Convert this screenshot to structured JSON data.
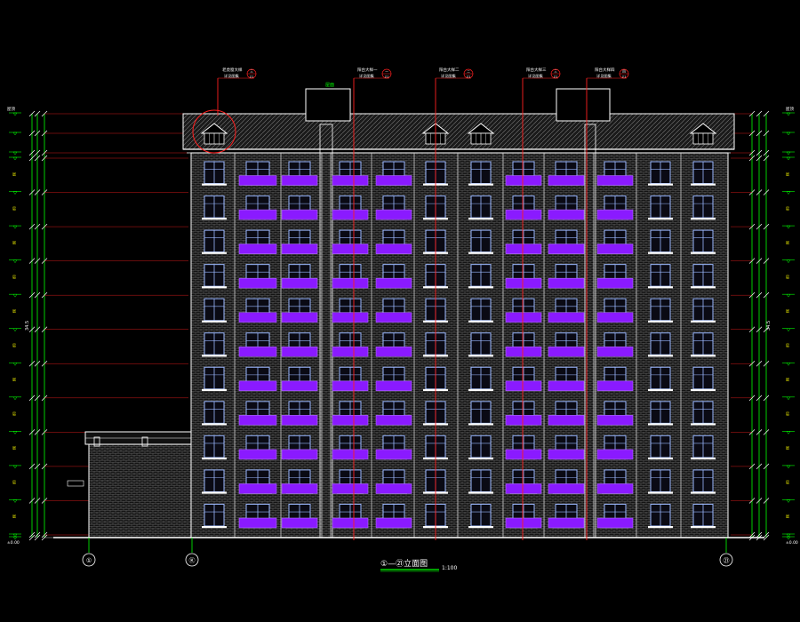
{
  "title": {
    "main": "①—㉑立面图",
    "scale": "1:100"
  },
  "grid_axes": {
    "left": "①",
    "middle": "Ⓚ",
    "right": "㉑"
  },
  "section_callouts": [
    {
      "text": "老虎窗大样",
      "sub": "详见图集",
      "ref": "三",
      "page": "21"
    },
    {
      "text": "阳台大样一",
      "sub": "详见图集",
      "ref": "一",
      "page": "21"
    },
    {
      "text": "阳台大样二",
      "sub": "详见图集",
      "ref": "二",
      "page": "21"
    },
    {
      "text": "阳台大样三",
      "sub": "详见图集",
      "ref": "三",
      "page": "21"
    },
    {
      "text": "阳台大样四",
      "sub": "详见图集",
      "ref": "四",
      "page": "21"
    }
  ],
  "roof_labels": {
    "stair_tower": "屋面",
    "roof_mark": "屋顶"
  },
  "level_labels": {
    "ground": "±0.00",
    "ground_right": "±0.00",
    "floor_tag": "层",
    "overall": "34.5",
    "left_top": "屋顶",
    "right_top": "屋顶"
  },
  "colors": {
    "background": "#000000",
    "structure": "#ffffff",
    "dimension": "#00ff00",
    "leader": "#ff2020",
    "window": "#9bb8ff",
    "balcony": "#8a1aff",
    "brick": "#6e6e6e",
    "annotation": "#ffff00"
  },
  "elevation": {
    "floors": 11,
    "annex_floors": 3
  }
}
